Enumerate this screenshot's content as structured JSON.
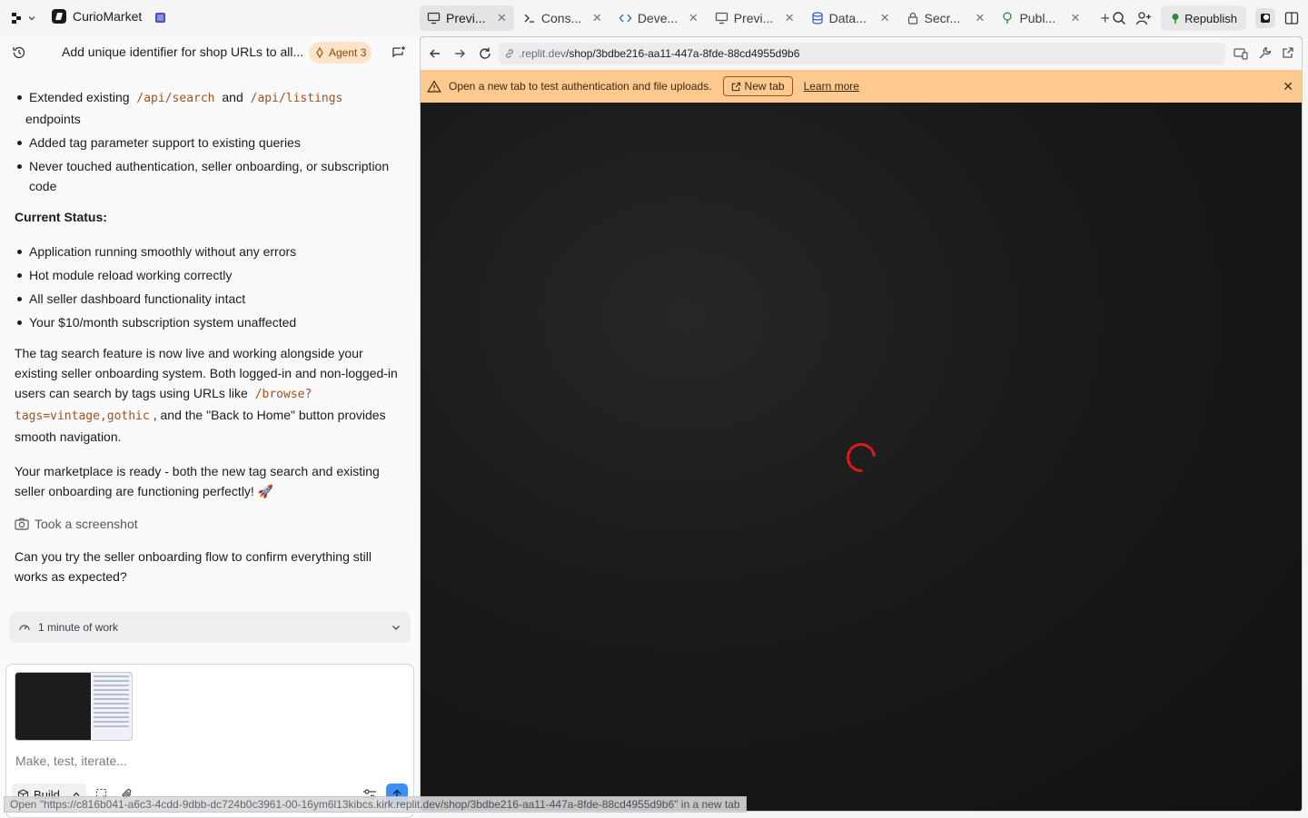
{
  "app": {
    "name": "CurioMarket"
  },
  "tabs": [
    {
      "label": "Previ...",
      "icon": "monitor-icon",
      "active": true
    },
    {
      "label": "Cons...",
      "icon": "terminal-icon"
    },
    {
      "label": "Deve...",
      "icon": "code-icon"
    },
    {
      "label": "Previ...",
      "icon": "monitor-icon"
    },
    {
      "label": "Data...",
      "icon": "database-icon"
    },
    {
      "label": "Secr...",
      "icon": "lock-icon"
    },
    {
      "label": "Publ...",
      "icon": "publish-icon"
    }
  ],
  "topbar": {
    "republish_label": "Republish"
  },
  "chat": {
    "title": "Add unique identifier for shop URLs to all...",
    "agent_badge": "Agent 3",
    "bullets_top": [
      {
        "pre": "Extended existing ",
        "code1": "/api/search",
        "mid": " and ",
        "code2": "/api/listings",
        "post": " endpoints"
      },
      {
        "text": "Added tag parameter support to existing queries"
      },
      {
        "text": "Never touched authentication, seller onboarding, or subscription code"
      }
    ],
    "status_heading": "Current Status:",
    "status_items": [
      "Application running smoothly without any errors",
      "Hot module reload working correctly",
      "All seller dashboard functionality intact",
      "Your $10/month subscription system unaffected"
    ],
    "para1_a": "The tag search feature is now live and working alongside your existing seller onboarding system. Both logged-in and non-logged-in users can search by tags using URLs like ",
    "para1_code": "/browse?tags=vintage,gothic",
    "para1_b": ", and the \"Back to Home\" button provides smooth navigation.",
    "para2": "Your marketplace is ready - both the new tag search and existing seller onboarding are functioning perfectly! 🚀",
    "screenshot_label": "Took a screenshot",
    "question": "Can you try the seller onboarding flow to confirm everything still works as expected?",
    "work_label": "1 minute of work"
  },
  "composer": {
    "placeholder": "Make, test, iterate...",
    "build_label": "Build"
  },
  "preview": {
    "url_domain": ".replit.dev",
    "url_path": "/shop/3bdbe216-aa11-447a-8fde-88cd4955d9b6",
    "warning": "Open a new tab to test authentication and file uploads.",
    "new_tab_label": "New tab",
    "learn_more": "Learn more"
  },
  "statusbar": {
    "text": "Open \"https://c816b041-a6c3-4cdd-9dbb-dc724b0c3961-00-16ym6l13kibcs.kirk.replit.dev/shop/3bdbe216-aa11-447a-8fde-88cd4955d9b6\" in a new tab"
  },
  "colors": {
    "accent": "#3e8ef7",
    "warning_bg": "#fdc98f",
    "spinner": "#e01818",
    "badge_bg": "#fde4c8"
  }
}
